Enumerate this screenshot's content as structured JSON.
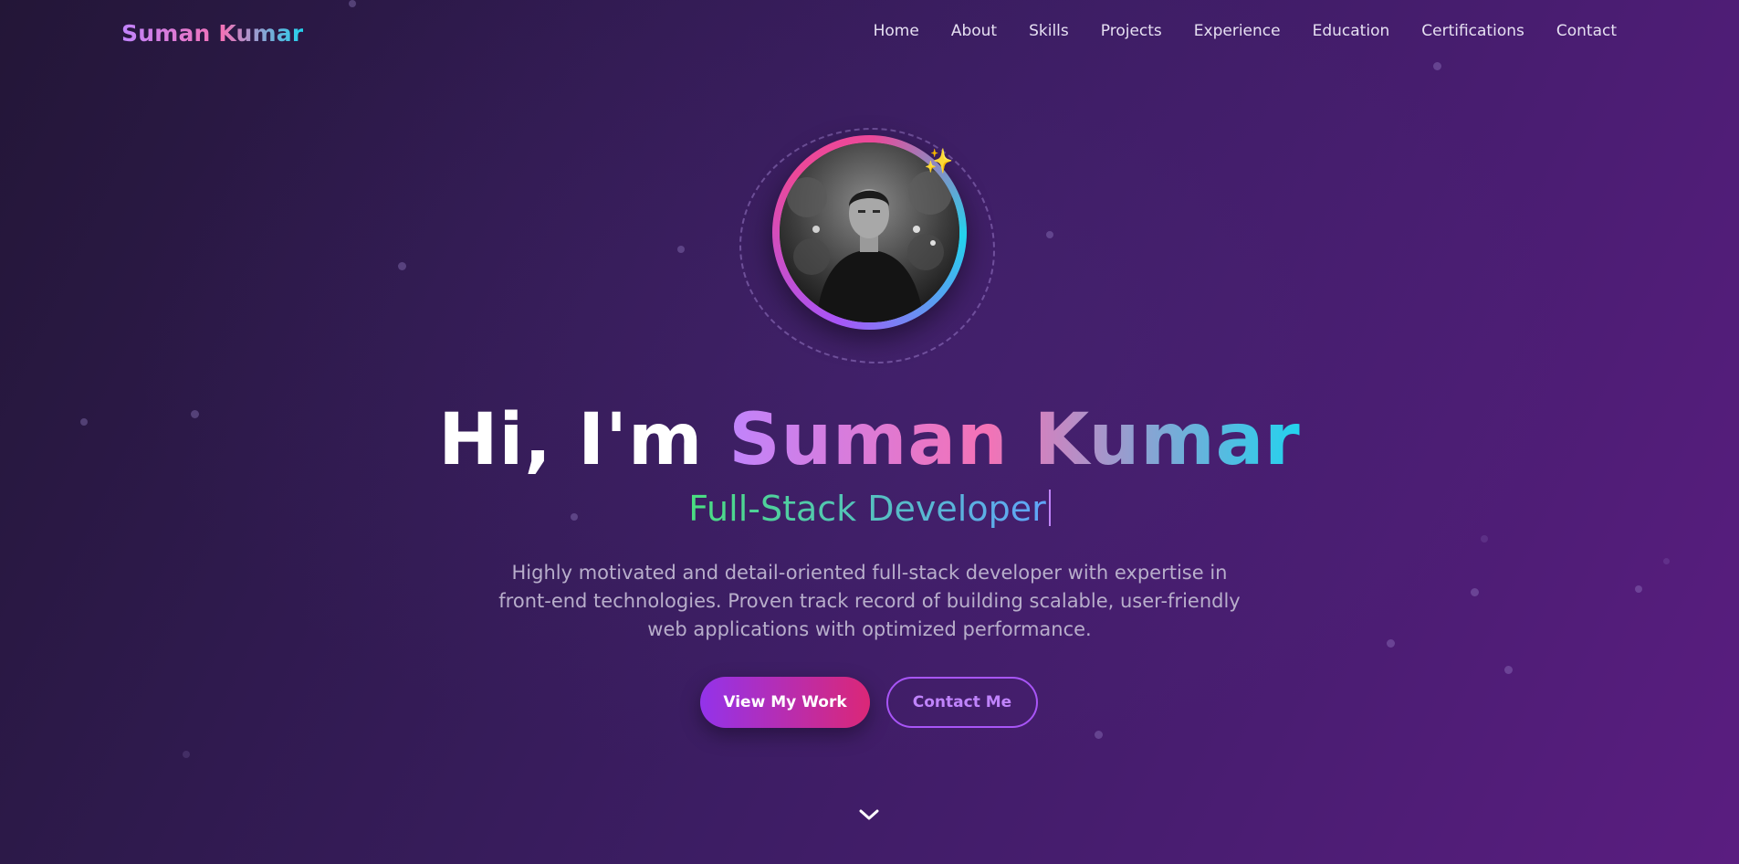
{
  "nav": {
    "brand": "Suman Kumar",
    "links": [
      "Home",
      "About",
      "Skills",
      "Projects",
      "Experience",
      "Education",
      "Certifications",
      "Contact"
    ]
  },
  "hero": {
    "greeting": "Hi, I'm ",
    "name": "Suman Kumar",
    "role": "Full-Stack Developer",
    "tagline": "Highly motivated and detail-oriented full-stack developer with expertise in front-end technologies. Proven track record of building scalable, user-friendly web applications with optimized performance.",
    "sparkle_glyph": "✨",
    "primary_button": "View My Work",
    "secondary_button": "Contact Me",
    "scroll_icon": "chevron-down-icon"
  },
  "colors": {
    "accent_purple": "#a855f7",
    "accent_pink": "#ec4899",
    "accent_cyan": "#22d3ee",
    "role_green": "#4ade80",
    "role_blue": "#60a5fa"
  }
}
